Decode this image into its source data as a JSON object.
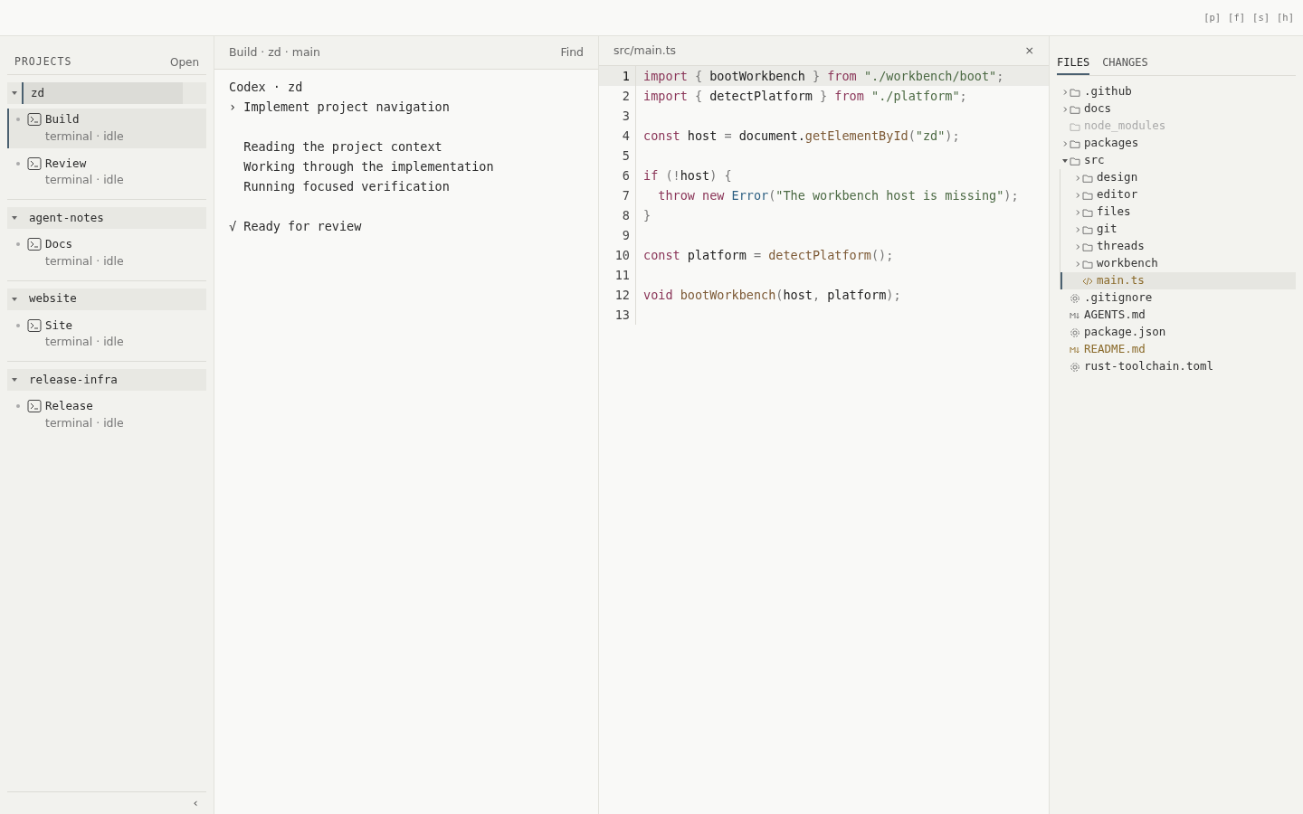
{
  "top_bar": {
    "shortcuts": [
      "[p]",
      "[f]",
      "[s]",
      "[h]"
    ]
  },
  "sidebar": {
    "title": "PROJECTS",
    "action": "Open",
    "collapse": "‹",
    "projects": [
      {
        "name": "zd",
        "expanded": true,
        "selected": true,
        "sessions": [
          {
            "name": "Build",
            "meta": "terminal · idle",
            "selected": true
          },
          {
            "name": "Review",
            "meta": "terminal · idle",
            "selected": false
          }
        ]
      },
      {
        "name": "agent-notes",
        "expanded": true,
        "selected": false,
        "sessions": [
          {
            "name": "Docs",
            "meta": "terminal · idle",
            "selected": false
          }
        ]
      },
      {
        "name": "website",
        "expanded": true,
        "selected": false,
        "sessions": [
          {
            "name": "Site",
            "meta": "terminal · idle",
            "selected": false
          }
        ]
      },
      {
        "name": "release-infra",
        "expanded": true,
        "selected": false,
        "sessions": [
          {
            "name": "Release",
            "meta": "terminal · idle",
            "selected": false
          }
        ]
      }
    ]
  },
  "thread": {
    "breadcrumb": "Build · zd · main",
    "find": "Find",
    "blocks": [
      {
        "lines": [
          {
            "kind": "title",
            "text": "Codex · zd"
          },
          {
            "kind": "prompt",
            "text": "› Implement project navigation"
          }
        ]
      },
      {
        "lines": [
          {
            "kind": "step",
            "text": "Reading the project context"
          },
          {
            "kind": "step",
            "text": "Working through the implementation"
          },
          {
            "kind": "step",
            "text": "Running focused verification"
          }
        ]
      },
      {
        "lines": [
          {
            "kind": "done",
            "text": "√ Ready for review"
          }
        ]
      }
    ]
  },
  "editor": {
    "tab": "src/main.ts",
    "close": "×",
    "lines": [
      {
        "number": "1",
        "active": true,
        "tokens": [
          {
            "kind": "kw",
            "text": "import"
          },
          {
            "kind": "punct",
            "text": " { "
          },
          {
            "kind": "plain",
            "text": "bootWorkbench"
          },
          {
            "kind": "punct",
            "text": " } "
          },
          {
            "kind": "kw",
            "text": "from"
          },
          {
            "kind": "str",
            "text": " \"./workbench/boot\""
          },
          {
            "kind": "punct",
            "text": ";"
          }
        ]
      },
      {
        "number": "2",
        "active": false,
        "tokens": [
          {
            "kind": "kw",
            "text": "import"
          },
          {
            "kind": "punct",
            "text": " { "
          },
          {
            "kind": "plain",
            "text": "detectPlatform"
          },
          {
            "kind": "punct",
            "text": " } "
          },
          {
            "kind": "kw",
            "text": "from"
          },
          {
            "kind": "str",
            "text": " \"./platform\""
          },
          {
            "kind": "punct",
            "text": ";"
          }
        ]
      },
      {
        "number": "3",
        "active": false
      },
      {
        "number": "4",
        "active": false,
        "tokens": [
          {
            "kind": "kw",
            "text": "const"
          },
          {
            "kind": "plain",
            "text": " host "
          },
          {
            "kind": "punct",
            "text": "= "
          },
          {
            "kind": "plain",
            "text": "document."
          },
          {
            "kind": "fn",
            "text": "getElementById"
          },
          {
            "kind": "punct",
            "text": "("
          },
          {
            "kind": "str",
            "text": "\"zd\""
          },
          {
            "kind": "punct",
            "text": ");"
          }
        ]
      },
      {
        "number": "5",
        "active": false
      },
      {
        "number": "6",
        "active": false,
        "tokens": [
          {
            "kind": "kw",
            "text": "if"
          },
          {
            "kind": "punct",
            "text": " (!"
          },
          {
            "kind": "plain",
            "text": "host"
          },
          {
            "kind": "punct",
            "text": ") {"
          }
        ]
      },
      {
        "number": "7",
        "active": false,
        "indented": true,
        "tokens": [
          {
            "kind": "kw",
            "text": "throw new"
          },
          {
            "kind": "type",
            "text": " Error"
          },
          {
            "kind": "punct",
            "text": "("
          },
          {
            "kind": "str",
            "text": "\"The workbench host is missing\""
          },
          {
            "kind": "punct",
            "text": ");"
          }
        ]
      },
      {
        "number": "8",
        "active": false,
        "tokens": [
          {
            "kind": "punct",
            "text": "}"
          }
        ]
      },
      {
        "number": "9",
        "active": false
      },
      {
        "number": "10",
        "active": false,
        "tokens": [
          {
            "kind": "kw",
            "text": "const"
          },
          {
            "kind": "plain",
            "text": " platform "
          },
          {
            "kind": "punct",
            "text": "= "
          },
          {
            "kind": "fn",
            "text": "detectPlatform"
          },
          {
            "kind": "punct",
            "text": "();"
          }
        ]
      },
      {
        "number": "11",
        "active": false
      },
      {
        "number": "12",
        "active": false,
        "tokens": [
          {
            "kind": "kw",
            "text": "void"
          },
          {
            "kind": "fn",
            "text": " bootWorkbench"
          },
          {
            "kind": "punct",
            "text": "("
          },
          {
            "kind": "plain",
            "text": "host"
          },
          {
            "kind": "punct",
            "text": ", "
          },
          {
            "kind": "plain",
            "text": "platform"
          },
          {
            "kind": "punct",
            "text": ");"
          }
        ]
      },
      {
        "number": "13",
        "active": false
      }
    ]
  },
  "files": {
    "tabs": [
      {
        "label": "FILES",
        "selected": true
      },
      {
        "label": "CHANGES",
        "selected": false
      }
    ],
    "tree": [
      {
        "name": ".github",
        "kind": "folder",
        "expanded": false,
        "dimmed": false
      },
      {
        "name": "docs",
        "kind": "folder",
        "expanded": false,
        "dimmed": false
      },
      {
        "name": "node_modules",
        "kind": "folder",
        "dimmed": true
      },
      {
        "name": "packages",
        "kind": "folder",
        "expanded": false,
        "dimmed": false
      },
      {
        "name": "src",
        "kind": "folder",
        "expanded": true,
        "dimmed": false,
        "children": [
          {
            "name": "design",
            "kind": "folder",
            "expanded": false,
            "dimmed": false
          },
          {
            "name": "editor",
            "kind": "folder",
            "expanded": false,
            "dimmed": false
          },
          {
            "name": "files",
            "kind": "folder",
            "expanded": false,
            "dimmed": false
          },
          {
            "name": "git",
            "kind": "folder",
            "expanded": false,
            "dimmed": false
          },
          {
            "name": "threads",
            "kind": "folder",
            "expanded": false,
            "dimmed": false
          },
          {
            "name": "workbench",
            "kind": "folder",
            "expanded": false,
            "dimmed": false
          },
          {
            "name": "main.ts",
            "kind": "code",
            "selected": true,
            "modified": true
          }
        ]
      },
      {
        "name": ".gitignore",
        "kind": "config",
        "selected": false,
        "modified": false
      },
      {
        "name": "AGENTS.md",
        "kind": "markdown",
        "selected": false,
        "modified": false
      },
      {
        "name": "package.json",
        "kind": "config",
        "selected": false,
        "modified": false
      },
      {
        "name": "README.md",
        "kind": "markdown",
        "selected": false,
        "modified": true
      },
      {
        "name": "rust-toolchain.toml",
        "kind": "config",
        "selected": false,
        "modified": false
      }
    ]
  }
}
